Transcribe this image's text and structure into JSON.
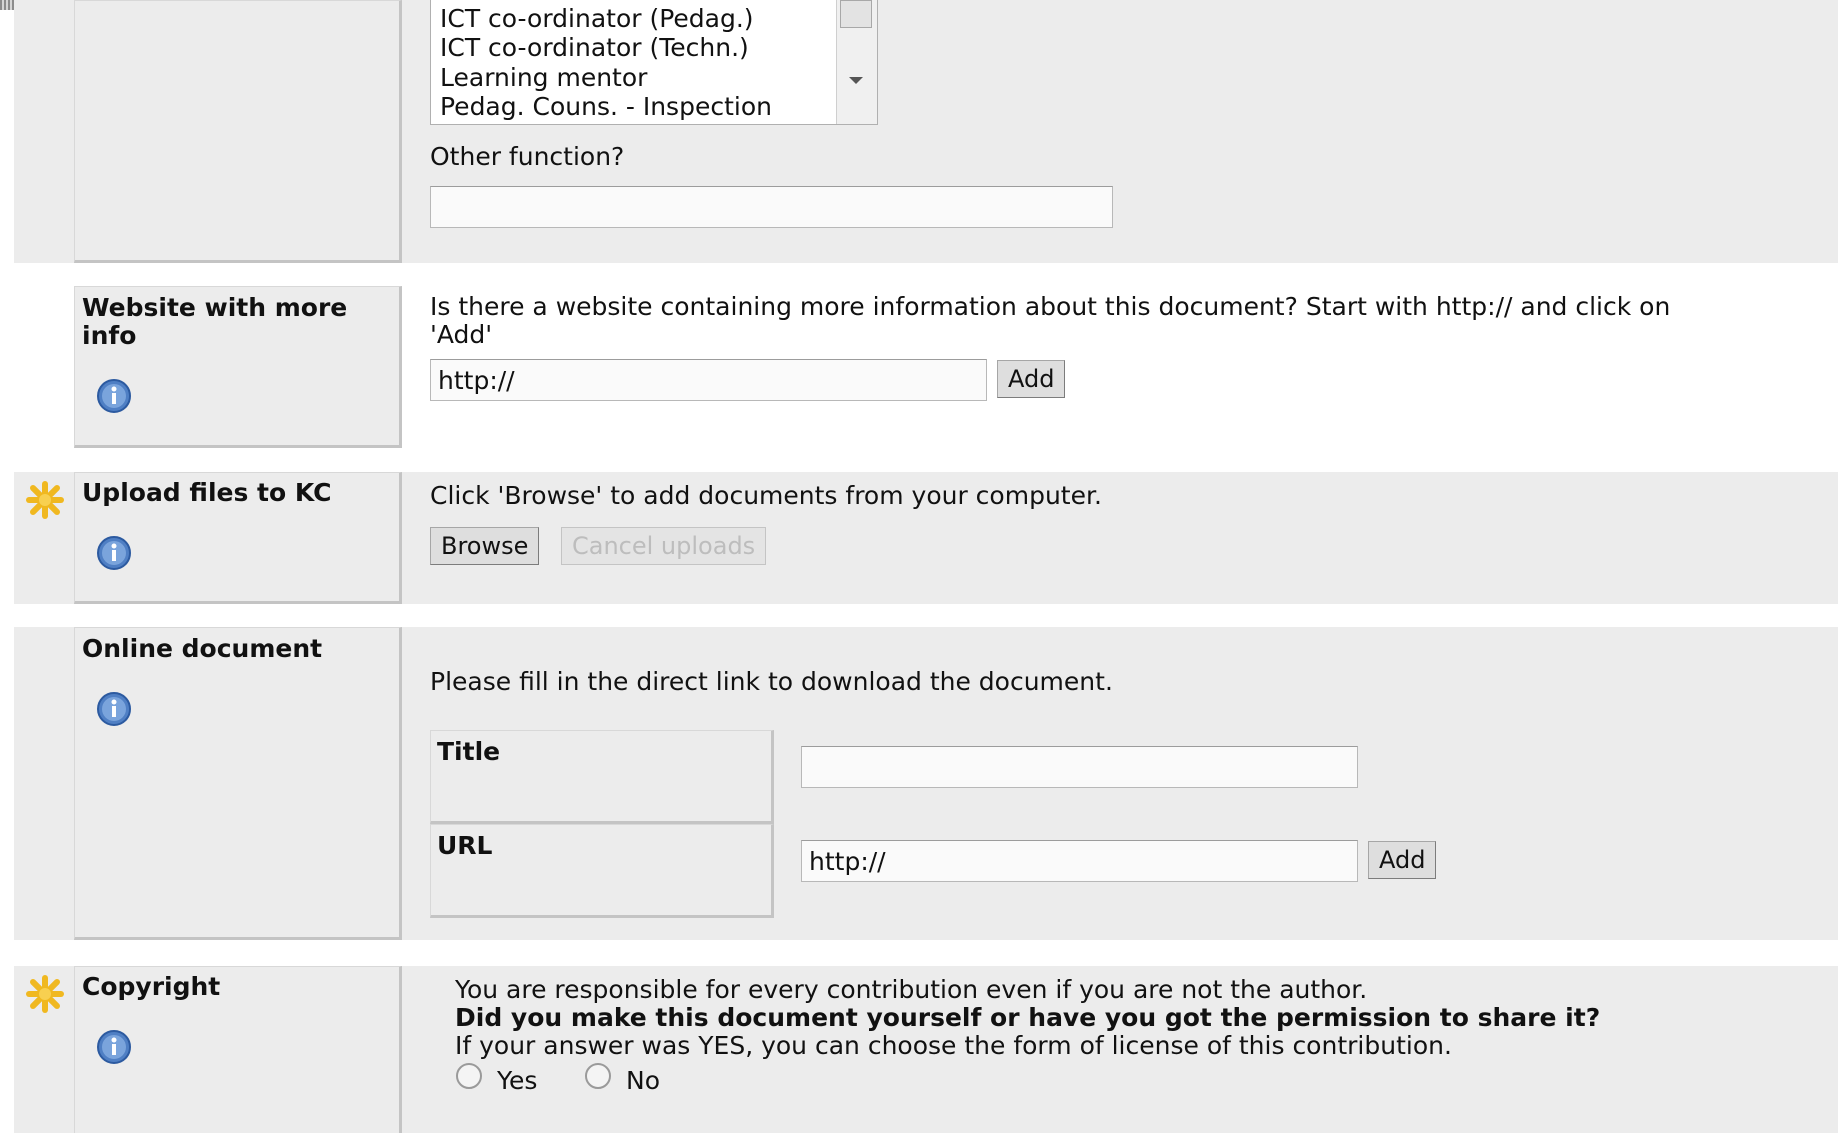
{
  "function_section": {
    "options": [
      "ICT co-ordinator (Pedag.)",
      "ICT co-ordinator (Techn.)",
      "Learning mentor",
      "Pedag. Couns. - Inspection"
    ],
    "other_label": "Other function?",
    "other_value": ""
  },
  "website_section": {
    "label": "Website with more info",
    "prompt_line1": "Is there a website containing more information about this document? Start with http:// and click on",
    "prompt_line2": "'Add'",
    "url_value": "http://",
    "add_label": "Add"
  },
  "upload_section": {
    "label": "Upload files to KC",
    "prompt": "Click 'Browse' to add documents from your computer.",
    "browse_label": "Browse",
    "cancel_label": "Cancel uploads"
  },
  "online_section": {
    "label": "Online document",
    "prompt": "Please fill in the direct link to download the document.",
    "title_label": "Title",
    "title_value": "",
    "url_label": "URL",
    "url_value": "http://",
    "add_label": "Add"
  },
  "copyright_section": {
    "label": "Copyright",
    "line1": "You are responsible for every contribution even if you are not the author.",
    "line2": "Did you make this document yourself or have you got the permission to share it?",
    "line3": "If your answer was YES, you can choose the form of license of this contribution.",
    "yes_label": "Yes",
    "no_label": "No"
  },
  "colors": {
    "band": "#ececec",
    "info_icon": "#4f7fc4",
    "required_star": "#f0b820"
  },
  "icons": {
    "info": "info-icon",
    "required": "required-star-icon"
  }
}
